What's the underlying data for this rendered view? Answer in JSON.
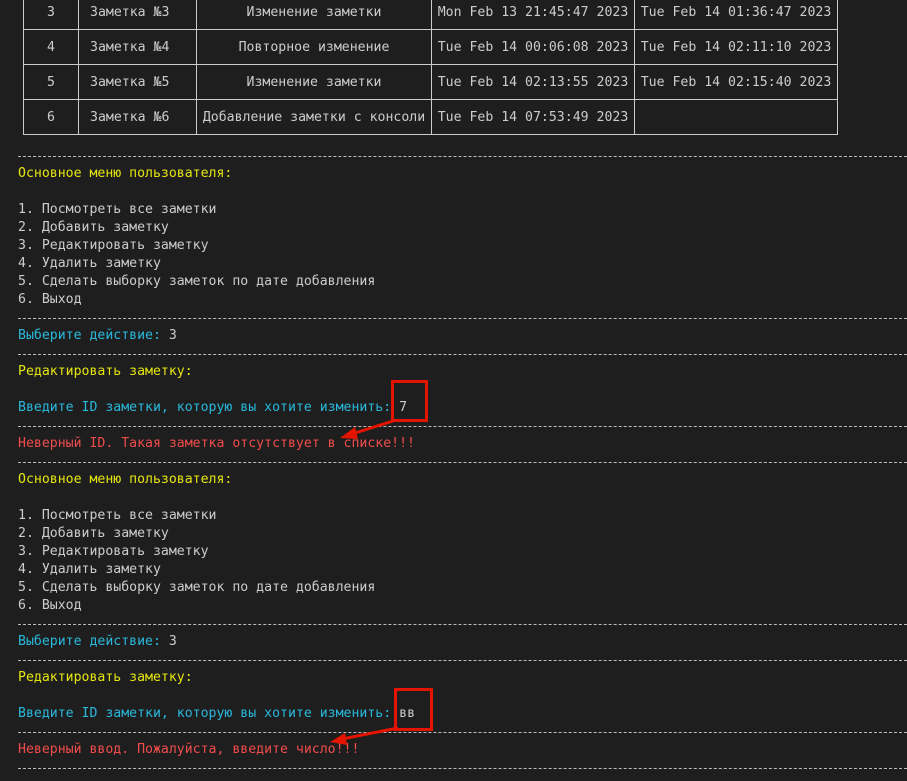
{
  "table": {
    "rows": [
      {
        "id": "3",
        "title": "Заметка №3",
        "text": "Изменение заметки",
        "created": "Mon Feb 13 21:45:47 2023",
        "changed": "Tue Feb 14 01:36:47 2023"
      },
      {
        "id": "4",
        "title": "Заметка №4",
        "text": "Повторное изменение",
        "created": "Tue Feb 14 00:06:08 2023",
        "changed": "Tue Feb 14 02:11:10 2023"
      },
      {
        "id": "5",
        "title": "Заметка №5",
        "text": "Изменение заметки",
        "created": "Tue Feb 14 02:13:55 2023",
        "changed": "Tue Feb 14 02:15:40 2023"
      },
      {
        "id": "6",
        "title": "Заметка №6",
        "text": "Добавление заметки с консоли",
        "created": "Tue Feb 14 07:53:49 2023",
        "changed": ""
      }
    ]
  },
  "block1": {
    "menu_title": "Основное меню пользователя:",
    "menu_items": [
      "1. Посмотреть все заметки",
      "2. Добавить заметку",
      "3. Редактировать заметку",
      "4. Удалить заметку",
      "5. Сделать выборку заметок по дате добавления",
      "6. Выход"
    ],
    "choose_prompt": "Выберите действие:",
    "choose_value": "3",
    "edit_title": "Редактировать заметку:",
    "id_prompt": "Введите ID заметки, которую вы хотите изменить:",
    "id_value": "7",
    "error": "Неверный ID. Такая заметка отсутствует в списке!!!"
  },
  "block2": {
    "menu_title": "Основное меню пользователя:",
    "menu_items": [
      "1. Посмотреть все заметки",
      "2. Добавить заметку",
      "3. Редактировать заметку",
      "4. Удалить заметку",
      "5. Сделать выборку заметок по дате добавления",
      "6. Выход"
    ],
    "choose_prompt": "Выберите действие:",
    "choose_value": "3",
    "edit_title": "Редактировать заметку:",
    "id_prompt": "Введите ID заметки, которую вы хотите изменить:",
    "id_value": "вв",
    "error": "Неверный ввод. Пожалуйста, введите число!!!"
  },
  "colors": {
    "background": "#1e1e1e",
    "text": "#cccccc",
    "heading": "#e5e510",
    "prompt": "#29b8db",
    "error": "#f14c4c",
    "annotation": "#e51400"
  }
}
